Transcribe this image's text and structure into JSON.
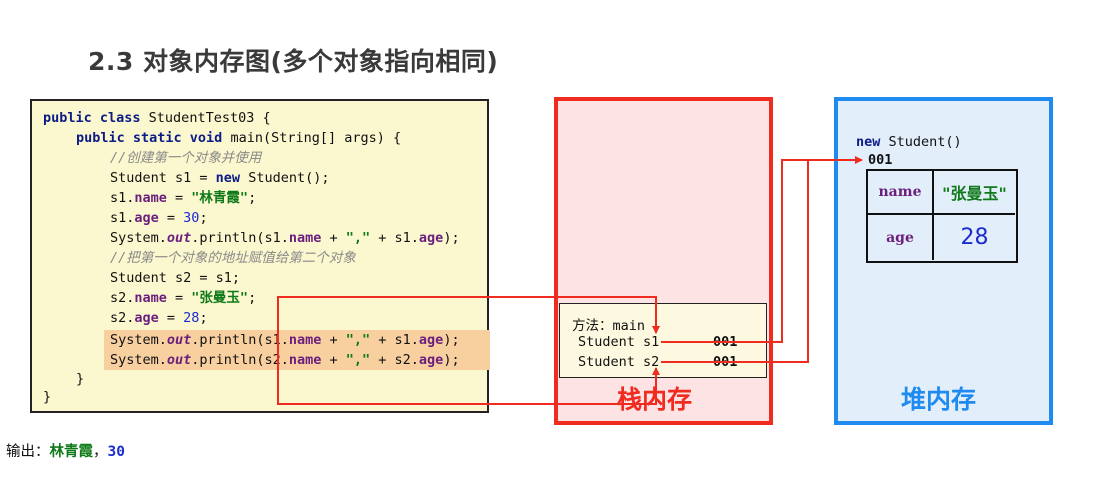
{
  "title": "2.3 对象内存图(多个对象指向相同)",
  "code": {
    "l1_kw": "public class",
    "l1_rest": " StudentTest03 {",
    "l2_kw": "public static void",
    "l2_rest": " main(String[] args) {",
    "c1": "//创建第一个对象并使用",
    "l4_a": "Student s1 = ",
    "l4_kw": "new",
    "l4_b": " Student();",
    "l5_a": "s1.",
    "l5_f": "name",
    "l5_b": " = ",
    "l5_s": "\"林青霞\"",
    "l5_c": ";",
    "l6_a": "s1.",
    "l6_f": "age",
    "l6_b": " = ",
    "l6_n": "30",
    "l6_c": ";",
    "l7_a": "System.",
    "l7_o": "out",
    "l7_b": ".println(s1.",
    "l7_f1": "name",
    "l7_c": " + ",
    "l7_s": "\",\"",
    "l7_d": " + s1.",
    "l7_f2": "age",
    "l7_e": ");",
    "c2": "//把第一个对象的地址赋值给第二个对象",
    "l9": "Student s2 = s1;",
    "l10_a": "s2.",
    "l10_f": "name",
    "l10_b": " = ",
    "l10_s": "\"张曼玉\"",
    "l10_c": ";",
    "l11_a": "s2.",
    "l11_f": "age",
    "l11_b": " = ",
    "l11_n": "28",
    "l11_c": ";",
    "l12_a": "System.",
    "l12_o": "out",
    "l12_b": ".println(s1.",
    "l12_f1": "name",
    "l12_c": " + ",
    "l12_s": "\",\"",
    "l12_d": " + s1.",
    "l12_f2": "age",
    "l12_e": ");",
    "l13_a": "System.",
    "l13_o": "out",
    "l13_b": ".println(s2.",
    "l13_f1": "name",
    "l13_c": " + ",
    "l13_s": "\",\"",
    "l13_d": " + s2.",
    "l13_f2": "age",
    "l13_e": ");",
    "close_inner": "}",
    "close_outer": "}"
  },
  "stack": {
    "label": "栈内存",
    "frame_title": "方法：main",
    "var1_name": "Student s1",
    "var1_value": "001",
    "var2_name": "Student s2",
    "var2_value": "001"
  },
  "heap": {
    "label": "堆内存",
    "new_kw": "new",
    "new_rest": " Student()",
    "address": "001",
    "field1_name": "name",
    "field1_value": "\"张曼玉\"",
    "field2_name": "age",
    "field2_value": "28"
  },
  "output": {
    "label": "输出：",
    "name": "林青霞",
    "sep": "，",
    "age": "30"
  },
  "colors": {
    "stack_red": "#f02c20",
    "heap_blue": "#1f8af0",
    "arrow_red": "#f02c20"
  }
}
